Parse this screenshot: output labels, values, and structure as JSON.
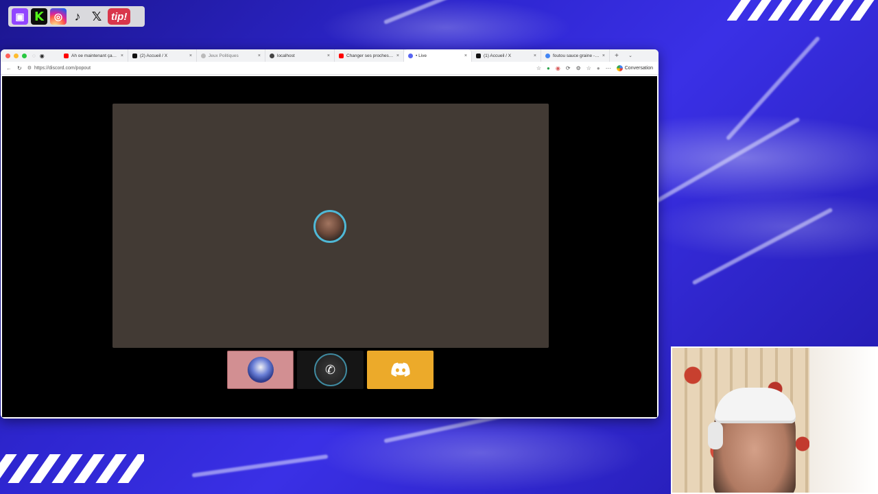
{
  "social": {
    "items": [
      {
        "name": "twitch",
        "glyph": "▣"
      },
      {
        "name": "kick",
        "glyph": "K"
      },
      {
        "name": "instagram",
        "glyph": "◎"
      },
      {
        "name": "tiktok",
        "glyph": "♪"
      },
      {
        "name": "x",
        "glyph": "𝕏"
      },
      {
        "name": "tip",
        "glyph": "tip!"
      }
    ]
  },
  "browser": {
    "tabs": [
      {
        "label": "Ah oe maintenant ça se",
        "favicon_color": "#ff0000",
        "active": false
      },
      {
        "label": "(2) Accueil / X",
        "favicon_color": "#111111",
        "active": false
      },
      {
        "label": "Jeux Politiques",
        "favicon_color": "#bbbbbb",
        "active": false
      },
      {
        "label": "localhost",
        "favicon_color": "#444444",
        "active": false
      },
      {
        "label": "Changer ses proches de",
        "favicon_color": "#ff0000",
        "active": false
      },
      {
        "label": "• Live",
        "favicon_color": "#5865f2",
        "active": true
      },
      {
        "label": "(1) Accueil / X",
        "favicon_color": "#111111",
        "active": false
      },
      {
        "label": "foutou sauce graine - Re",
        "favicon_color": "#4285f4",
        "active": false
      }
    ],
    "tab_close": "×",
    "new_tab": "+",
    "url": "https://discord.com/popout",
    "conversation_label": "Conversation"
  },
  "discord": {
    "discord_glyph": "🎮",
    "call_glyph": "✆"
  },
  "colors": {
    "stage_bg": "#423a34",
    "speaking_ring": "#4fb8d6",
    "discord_tile": "#ecaa2a",
    "self_tile": "#d28f92"
  }
}
